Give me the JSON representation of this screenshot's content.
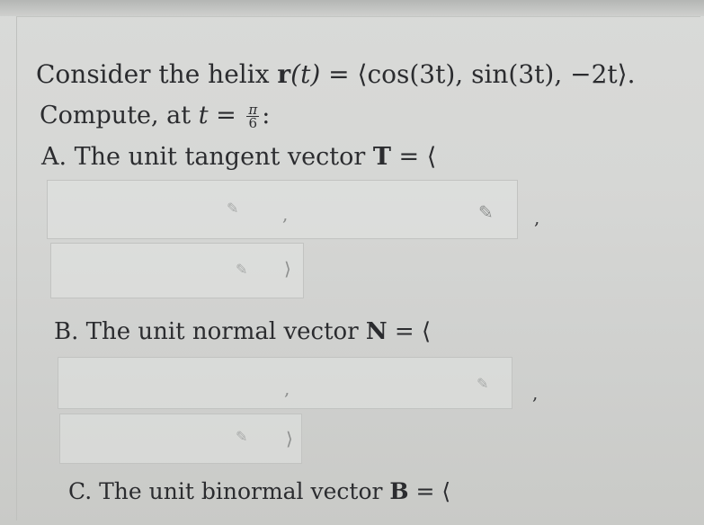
{
  "question": {
    "intro_text": "Consider the helix ",
    "r_symbol": "r",
    "r_arg": "(t)",
    "definition": " = ⟨cos(3t), sin(3t), −2t⟩."
  },
  "compute": {
    "prefix": "Compute, at ",
    "var": "t",
    "equals": " = ",
    "frac_num": "π",
    "frac_den": "6",
    "suffix": ":"
  },
  "part_a": {
    "label": "A. The unit tangent vector ",
    "symbol": "T",
    "open": " = ⟨"
  },
  "part_b": {
    "label": "B. The unit normal vector ",
    "symbol": "N",
    "open": " = ⟨"
  },
  "part_c": {
    "label": "C. The unit binormal vector ",
    "symbol": "B",
    "open": " = ⟨"
  },
  "separators": {
    "comma": ",",
    "close": "⟩"
  },
  "icons": {
    "edit": "pencil-icon"
  }
}
